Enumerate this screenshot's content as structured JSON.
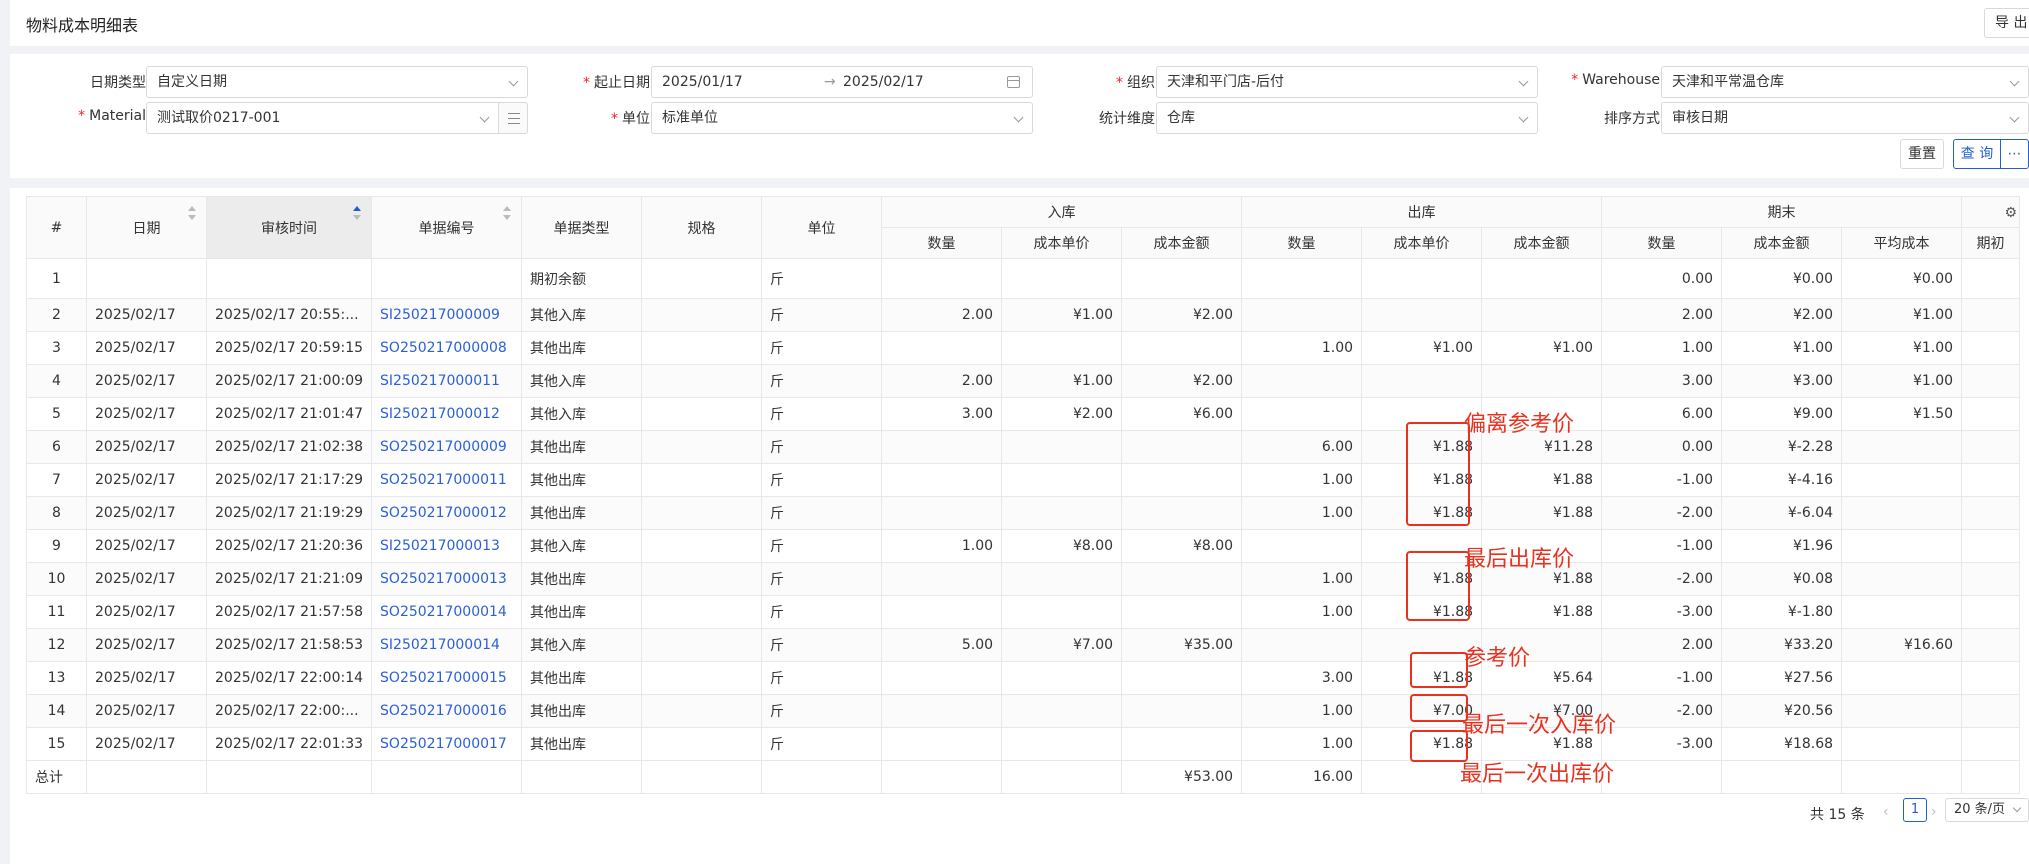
{
  "page": {
    "title": "物料成本明细表",
    "export_label": "导 出"
  },
  "filters": {
    "date_type": {
      "label": "日期类型",
      "value": "自定义日期"
    },
    "date_range": {
      "label": "起止日期",
      "start": "2025/01/17",
      "end": "2025/02/17"
    },
    "org": {
      "label": "组织",
      "value": "天津和平门店-后付"
    },
    "warehouse": {
      "label": "Warehouse",
      "value": "天津和平常温仓库"
    },
    "material": {
      "label": "Material",
      "value": "测试取价0217-001"
    },
    "unit": {
      "label": "单位",
      "value": "标准单位"
    },
    "dimension": {
      "label": "统计维度",
      "value": "仓库"
    },
    "sort": {
      "label": "排序方式",
      "value": "审核日期"
    },
    "reset_label": "重置",
    "query_label": "查 询",
    "more_label": "⋯"
  },
  "table": {
    "group_headers": {
      "in": "入库",
      "out": "出库",
      "end": "期末"
    },
    "headers": {
      "index": "#",
      "date": "日期",
      "audit_time": "审核时间",
      "doc_no": "单据编号",
      "doc_type": "单据类型",
      "spec": "规格",
      "unit": "单位",
      "qty": "数量",
      "unit_cost": "成本单价",
      "amount": "成本金额",
      "avg_cost": "平均成本",
      "end_extra": "期初"
    },
    "opening": {
      "index": "1",
      "doc_type": "期初余额",
      "unit": "斤",
      "end_qty": "0.00",
      "end_amount": "¥0.00",
      "avg": "¥0.00"
    },
    "rows": [
      {
        "index": "2",
        "date": "2025/02/17",
        "time": "2025/02/17 20:55:...",
        "doc": "SI250217000009",
        "type": "其他入库",
        "unit": "斤",
        "in_qty": "2.00",
        "in_price": "¥1.00",
        "in_amt": "¥2.00",
        "out_qty": "",
        "out_price": "",
        "out_amt": "",
        "end_qty": "2.00",
        "end_amt": "¥2.00",
        "avg": "¥1.00"
      },
      {
        "index": "3",
        "date": "2025/02/17",
        "time": "2025/02/17 20:59:15",
        "doc": "SO250217000008",
        "type": "其他出库",
        "unit": "斤",
        "in_qty": "",
        "in_price": "",
        "in_amt": "",
        "out_qty": "1.00",
        "out_price": "¥1.00",
        "out_amt": "¥1.00",
        "end_qty": "1.00",
        "end_amt": "¥1.00",
        "avg": "¥1.00"
      },
      {
        "index": "4",
        "date": "2025/02/17",
        "time": "2025/02/17 21:00:09",
        "doc": "SI250217000011",
        "type": "其他入库",
        "unit": "斤",
        "in_qty": "2.00",
        "in_price": "¥1.00",
        "in_amt": "¥2.00",
        "out_qty": "",
        "out_price": "",
        "out_amt": "",
        "end_qty": "3.00",
        "end_amt": "¥3.00",
        "avg": "¥1.00"
      },
      {
        "index": "5",
        "date": "2025/02/17",
        "time": "2025/02/17 21:01:47",
        "doc": "SI250217000012",
        "type": "其他入库",
        "unit": "斤",
        "in_qty": "3.00",
        "in_price": "¥2.00",
        "in_amt": "¥6.00",
        "out_qty": "",
        "out_price": "",
        "out_amt": "",
        "end_qty": "6.00",
        "end_amt": "¥9.00",
        "avg": "¥1.50"
      },
      {
        "index": "6",
        "date": "2025/02/17",
        "time": "2025/02/17 21:02:38",
        "doc": "SO250217000009",
        "type": "其他出库",
        "unit": "斤",
        "in_qty": "",
        "in_price": "",
        "in_amt": "",
        "out_qty": "6.00",
        "out_price": "¥1.88",
        "out_amt": "¥11.28",
        "end_qty": "0.00",
        "end_amt": "¥-2.28",
        "avg": ""
      },
      {
        "index": "7",
        "date": "2025/02/17",
        "time": "2025/02/17 21:17:29",
        "doc": "SO250217000011",
        "type": "其他出库",
        "unit": "斤",
        "in_qty": "",
        "in_price": "",
        "in_amt": "",
        "out_qty": "1.00",
        "out_price": "¥1.88",
        "out_amt": "¥1.88",
        "end_qty": "-1.00",
        "end_amt": "¥-4.16",
        "avg": ""
      },
      {
        "index": "8",
        "date": "2025/02/17",
        "time": "2025/02/17 21:19:29",
        "doc": "SO250217000012",
        "type": "其他出库",
        "unit": "斤",
        "in_qty": "",
        "in_price": "",
        "in_amt": "",
        "out_qty": "1.00",
        "out_price": "¥1.88",
        "out_amt": "¥1.88",
        "end_qty": "-2.00",
        "end_amt": "¥-6.04",
        "avg": ""
      },
      {
        "index": "9",
        "date": "2025/02/17",
        "time": "2025/02/17 21:20:36",
        "doc": "SI250217000013",
        "type": "其他入库",
        "unit": "斤",
        "in_qty": "1.00",
        "in_price": "¥8.00",
        "in_amt": "¥8.00",
        "out_qty": "",
        "out_price": "",
        "out_amt": "",
        "end_qty": "-1.00",
        "end_amt": "¥1.96",
        "avg": ""
      },
      {
        "index": "10",
        "date": "2025/02/17",
        "time": "2025/02/17 21:21:09",
        "doc": "SO250217000013",
        "type": "其他出库",
        "unit": "斤",
        "in_qty": "",
        "in_price": "",
        "in_amt": "",
        "out_qty": "1.00",
        "out_price": "¥1.88",
        "out_amt": "¥1.88",
        "end_qty": "-2.00",
        "end_amt": "¥0.08",
        "avg": ""
      },
      {
        "index": "11",
        "date": "2025/02/17",
        "time": "2025/02/17 21:57:58",
        "doc": "SO250217000014",
        "type": "其他出库",
        "unit": "斤",
        "in_qty": "",
        "in_price": "",
        "in_amt": "",
        "out_qty": "1.00",
        "out_price": "¥1.88",
        "out_amt": "¥1.88",
        "end_qty": "-3.00",
        "end_amt": "¥-1.80",
        "avg": ""
      },
      {
        "index": "12",
        "date": "2025/02/17",
        "time": "2025/02/17 21:58:53",
        "doc": "SI250217000014",
        "type": "其他入库",
        "unit": "斤",
        "in_qty": "5.00",
        "in_price": "¥7.00",
        "in_amt": "¥35.00",
        "out_qty": "",
        "out_price": "",
        "out_amt": "",
        "end_qty": "2.00",
        "end_amt": "¥33.20",
        "avg": "¥16.60"
      },
      {
        "index": "13",
        "date": "2025/02/17",
        "time": "2025/02/17 22:00:14",
        "doc": "SO250217000015",
        "type": "其他出库",
        "unit": "斤",
        "in_qty": "",
        "in_price": "",
        "in_amt": "",
        "out_qty": "3.00",
        "out_price": "¥1.88",
        "out_amt": "¥5.64",
        "end_qty": "-1.00",
        "end_amt": "¥27.56",
        "avg": ""
      },
      {
        "index": "14",
        "date": "2025/02/17",
        "time": "2025/02/17 22:00:...",
        "doc": "SO250217000016",
        "type": "其他出库",
        "unit": "斤",
        "in_qty": "",
        "in_price": "",
        "in_amt": "",
        "out_qty": "1.00",
        "out_price": "¥7.00",
        "out_amt": "¥7.00",
        "end_qty": "-2.00",
        "end_amt": "¥20.56",
        "avg": ""
      },
      {
        "index": "15",
        "date": "2025/02/17",
        "time": "2025/02/17 22:01:33",
        "doc": "SO250217000017",
        "type": "其他出库",
        "unit": "斤",
        "in_qty": "",
        "in_price": "",
        "in_amt": "",
        "out_qty": "1.00",
        "out_price": "¥1.88",
        "out_amt": "¥1.88",
        "end_qty": "-3.00",
        "end_amt": "¥18.68",
        "avg": ""
      }
    ],
    "total": {
      "label": "总计",
      "in_amt": "¥53.00",
      "out_qty": "16.00"
    }
  },
  "pagination": {
    "total_text": "共 15 条",
    "prev": "‹",
    "current": "1",
    "next": "›",
    "page_size": "20 条/页"
  },
  "annotations": {
    "deviation": "偏离参考价",
    "last_out_price": "最后出库价",
    "reference_price": "参考价",
    "last_in_price": "最后一次入库价",
    "last_out_once": "最后一次出库价",
    "color": "#e8311f"
  }
}
